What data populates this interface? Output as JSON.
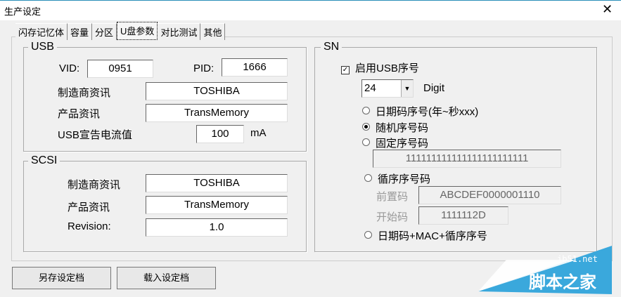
{
  "window": {
    "title": "生产设定",
    "close": "✕"
  },
  "tabs": [
    "闪存记忆体",
    "容量",
    "分区",
    "U盘参数",
    "对比测试",
    "其他"
  ],
  "usb": {
    "label": "USB",
    "vid_label": "VID:",
    "vid": "0951",
    "pid_label": "PID:",
    "pid": "1666",
    "vendor_label": "制造商资讯",
    "vendor": "TOSHIBA",
    "product_label": "产品资讯",
    "product": "TransMemory",
    "current_label": "USB宣告电流值",
    "current": "100",
    "current_unit": "mA"
  },
  "scsi": {
    "label": "SCSI",
    "vendor_label": "制造商资讯",
    "vendor": "TOSHIBA",
    "product_label": "产品资讯",
    "product": "TransMemory",
    "rev_label": "Revision:",
    "rev": "1.0"
  },
  "sn": {
    "label": "SN",
    "enable_label": "启用USB序号",
    "enabled": true,
    "digits": "24",
    "digit_label": "Digit",
    "opt_date": "日期码序号(年~秒xxx)",
    "opt_random": "随机序号码",
    "opt_fixed": "固定序号码",
    "fixed_value": "111111111111111111111111",
    "opt_seq": "循序序号码",
    "prefix_label": "前置码",
    "prefix": "ABCDEF0000001110",
    "start_label": "开始码",
    "start": "1111112D",
    "opt_mac": "日期码+MAC+循序序号"
  },
  "buttons": {
    "save": "另存设定档",
    "load": "载入设定档"
  },
  "watermark": {
    "site": "jb51.net",
    "name": "脚本之家"
  }
}
